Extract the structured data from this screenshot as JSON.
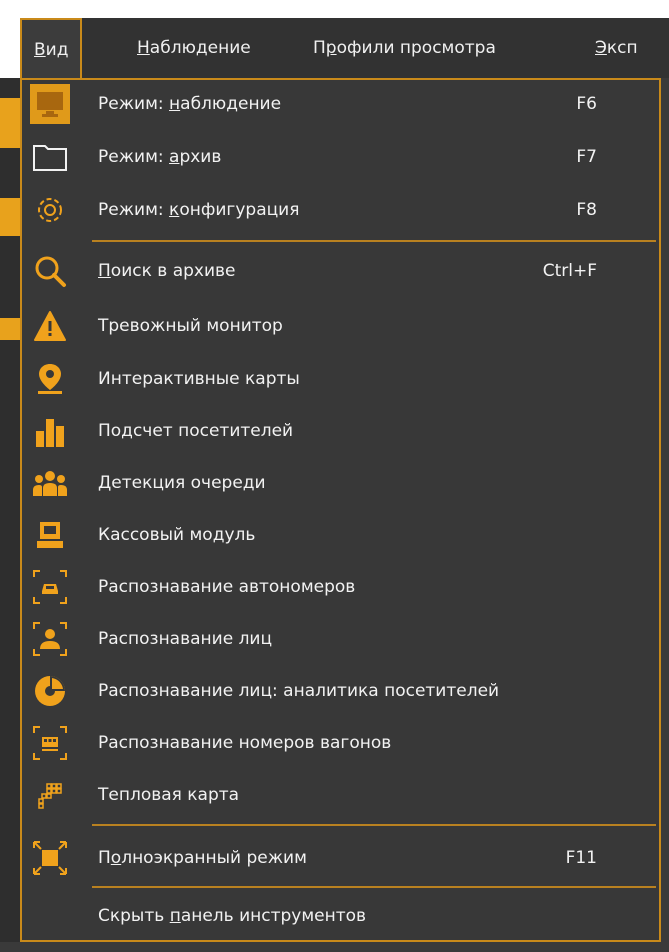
{
  "colors": {
    "accent": "#f0a21c",
    "menu_bg": "#383838",
    "border": "#c98a1a",
    "text": "#f2f2f2"
  },
  "menubar": {
    "items": [
      {
        "label_underlined": "В",
        "label_rest": "ид"
      },
      {
        "label_underlined": "Н",
        "label_rest": "аблюдение"
      },
      {
        "label_pre": "П",
        "label_underlined": "р",
        "label_rest": "офили просмотра"
      },
      {
        "label_underlined": "Э",
        "label_rest": "ксп"
      }
    ]
  },
  "menu": {
    "items": [
      {
        "icon": "monitor-icon",
        "pre": "Режим: ",
        "u": "н",
        "post": "аблюдение",
        "shortcut": "F6"
      },
      {
        "icon": "folder-icon",
        "pre": "Режим: ",
        "u": "а",
        "post": "рхив",
        "shortcut": "F7"
      },
      {
        "icon": "gear-icon",
        "pre": "Режим: ",
        "u": "к",
        "post": "онфигурация",
        "shortcut": "F8"
      },
      {
        "icon": "search-icon",
        "pre": "",
        "u": "П",
        "post": "оиск в архиве",
        "shortcut": "Ctrl+F"
      },
      {
        "icon": "warning-icon",
        "pre": "",
        "u": "",
        "post": "Тревожный монитор",
        "shortcut": ""
      },
      {
        "icon": "map-pin-icon",
        "pre": "",
        "u": "",
        "post": "Интерактивные карты",
        "shortcut": ""
      },
      {
        "icon": "bar-chart-icon",
        "pre": "",
        "u": "",
        "post": "Подсчет посетителей",
        "shortcut": ""
      },
      {
        "icon": "people-group-icon",
        "pre": "",
        "u": "",
        "post": "Детекция очереди",
        "shortcut": ""
      },
      {
        "icon": "cash-register-icon",
        "pre": "",
        "u": "",
        "post": "Кассовый модуль",
        "shortcut": ""
      },
      {
        "icon": "car-plate-icon",
        "pre": "",
        "u": "",
        "post": "Распознавание автономеров",
        "shortcut": ""
      },
      {
        "icon": "face-recognition-icon",
        "pre": "",
        "u": "",
        "post": "Распознавание лиц",
        "shortcut": ""
      },
      {
        "icon": "pie-chart-icon",
        "pre": "",
        "u": "",
        "post": "Распознавание лиц: аналитика посетителей",
        "shortcut": ""
      },
      {
        "icon": "wagon-icon",
        "pre": "",
        "u": "",
        "post": "Распознавание номеров вагонов",
        "shortcut": ""
      },
      {
        "icon": "heatmap-icon",
        "pre": "",
        "u": "",
        "post": "Тепловая карта",
        "shortcut": ""
      },
      {
        "icon": "fullscreen-icon",
        "pre": "П",
        "u": "о",
        "post": "лноэкранный режим",
        "shortcut": "F11"
      },
      {
        "icon": "",
        "pre": "Скрыть ",
        "u": "п",
        "post": "анель инструментов",
        "shortcut": ""
      }
    ]
  }
}
